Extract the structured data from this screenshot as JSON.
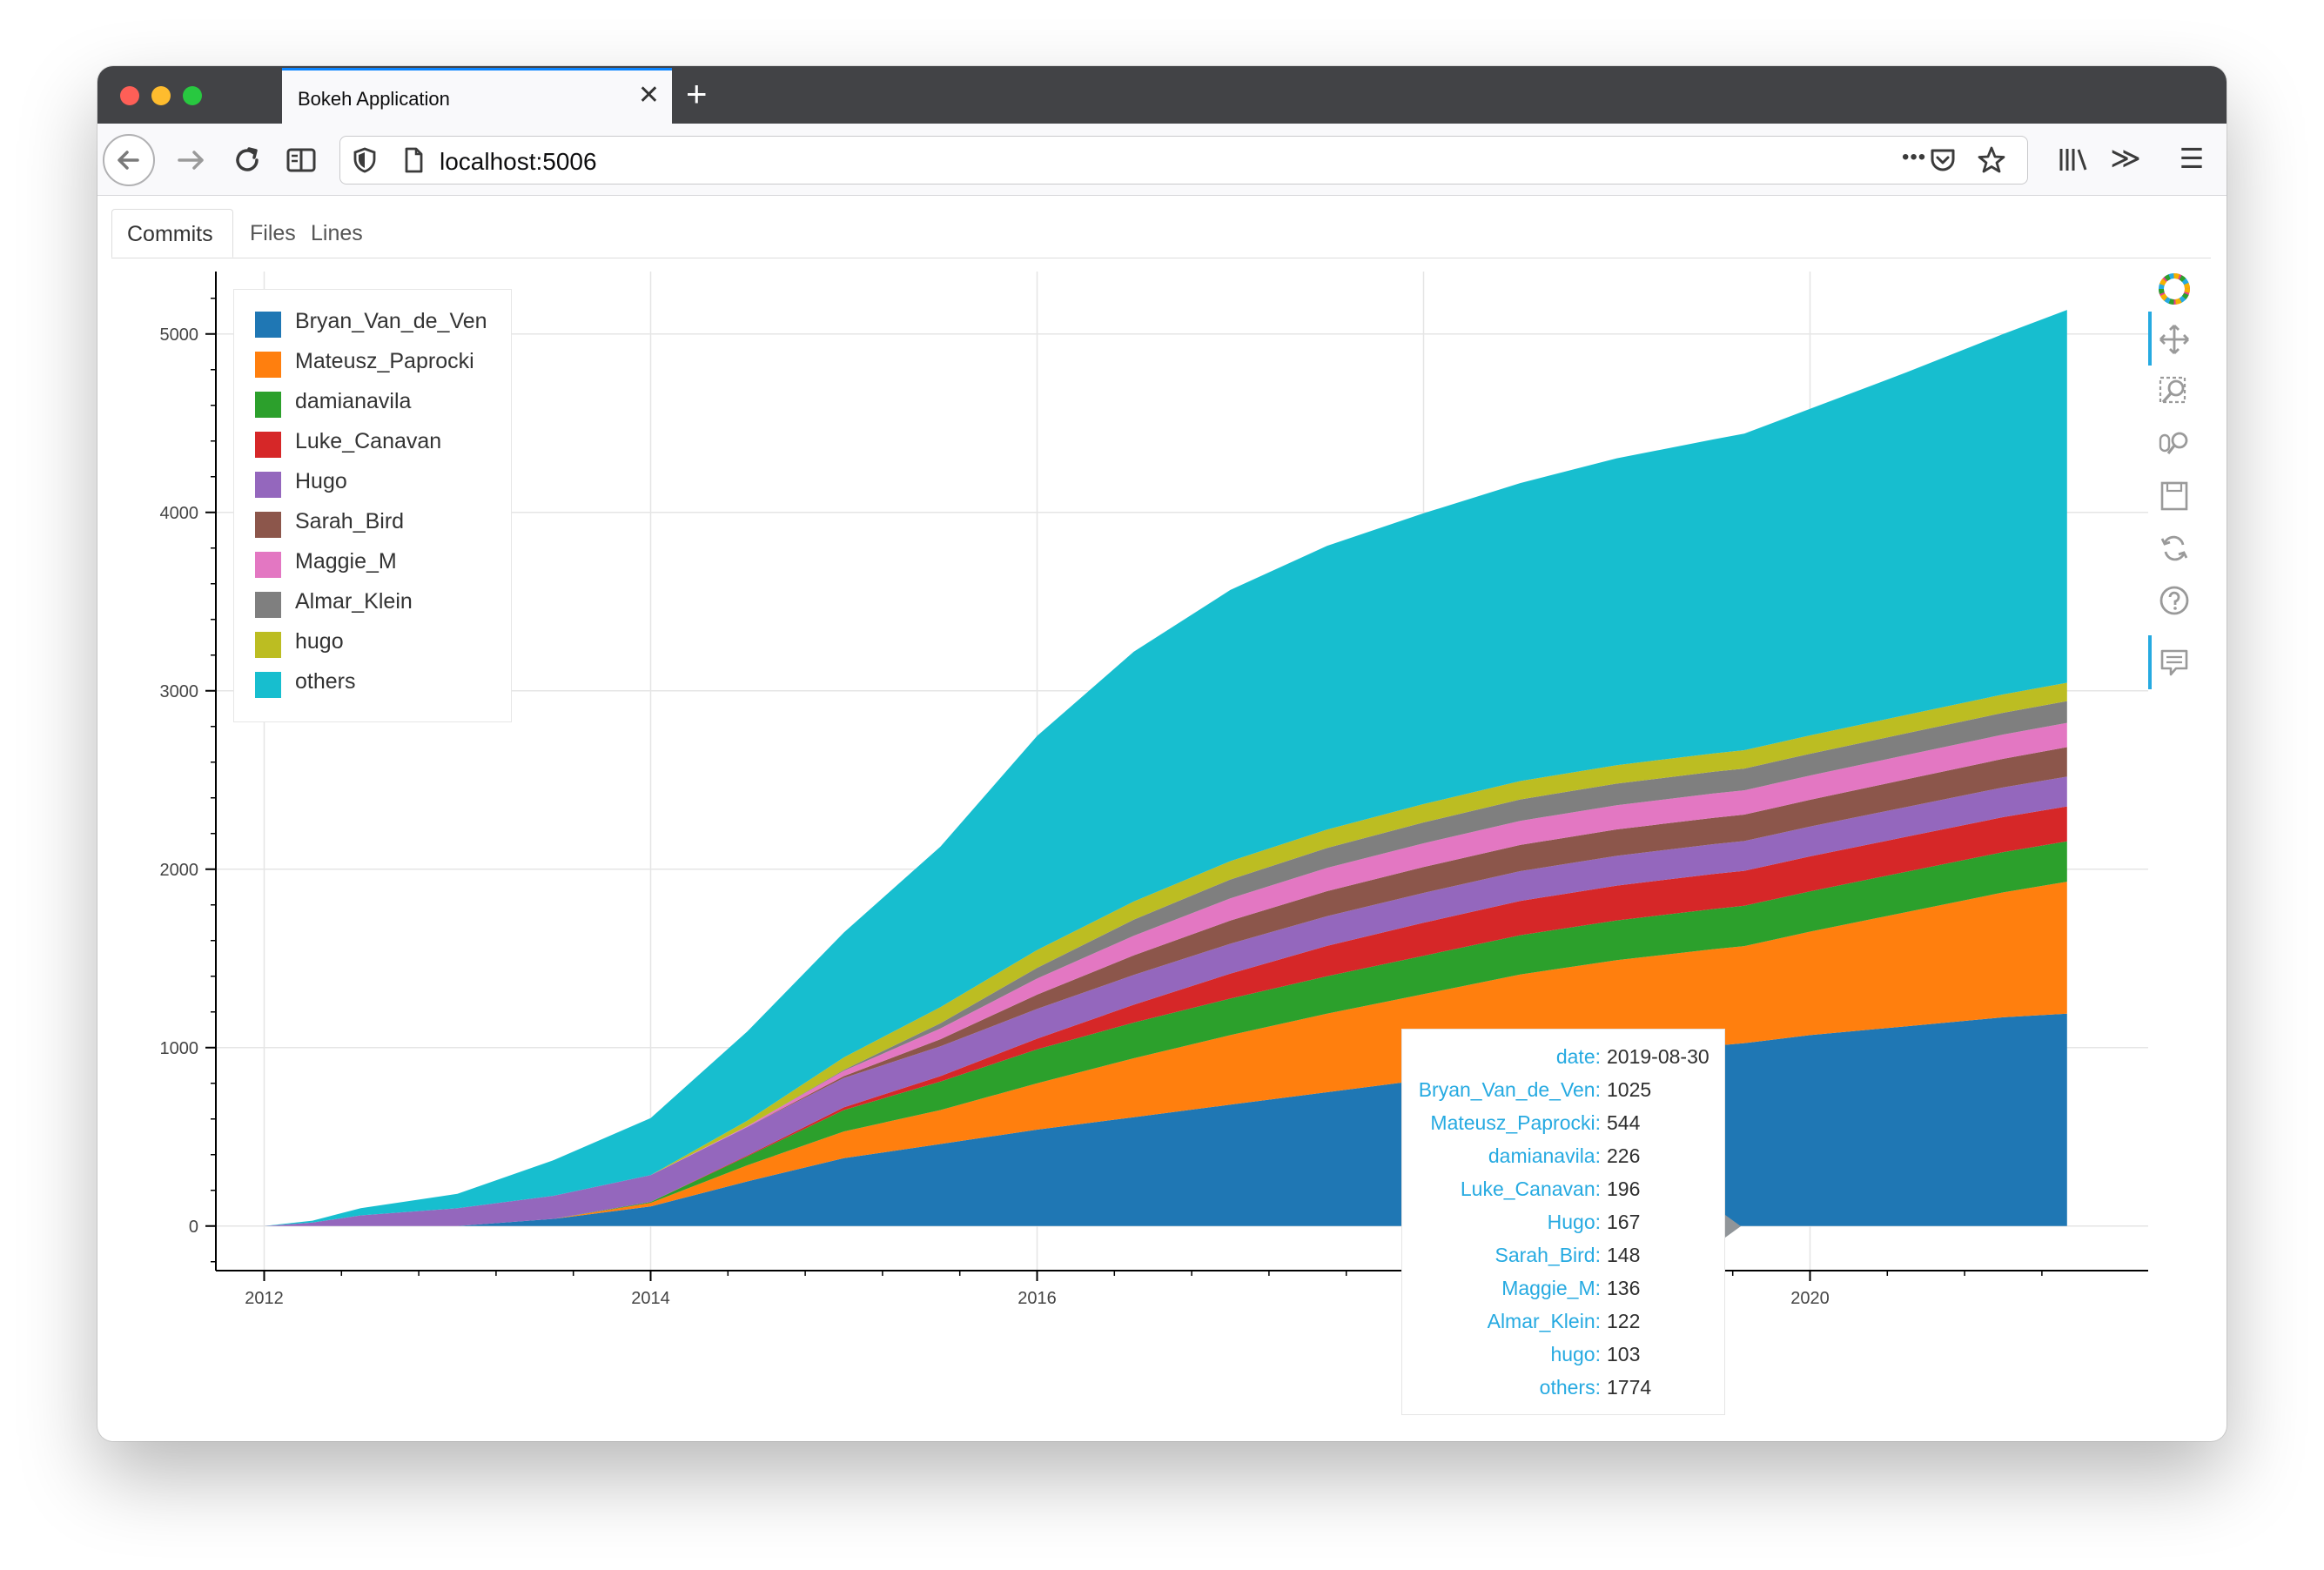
{
  "browser": {
    "tab_title": "Bokeh Application",
    "tab_close": "✕",
    "new_tab": "+",
    "url": "localhost:5006",
    "more_icon": "•••",
    "sidebar_icon": "≫",
    "menu_icon": "☰"
  },
  "page_tabs": [
    {
      "label": "Commits",
      "active": true
    },
    {
      "label": "Files",
      "active": false
    },
    {
      "label": "Lines",
      "active": false
    }
  ],
  "legend": [
    {
      "label": "Bryan_Van_de_Ven",
      "color": "#1f77b4"
    },
    {
      "label": "Mateusz_Paprocki",
      "color": "#ff7f0e"
    },
    {
      "label": "damianavila",
      "color": "#2ca02c"
    },
    {
      "label": "Luke_Canavan",
      "color": "#d62728"
    },
    {
      "label": "Hugo",
      "color": "#9467bd"
    },
    {
      "label": "Sarah_Bird",
      "color": "#8c564b"
    },
    {
      "label": "Maggie_M",
      "color": "#e377c2"
    },
    {
      "label": "Almar_Klein",
      "color": "#7f7f7f"
    },
    {
      "label": "hugo",
      "color": "#bcbd22"
    },
    {
      "label": "others",
      "color": "#17becf"
    }
  ],
  "tooltip": {
    "rows": [
      {
        "key": "date:",
        "value": "2019-08-30"
      },
      {
        "key": "Bryan_Van_de_Ven:",
        "value": "1025"
      },
      {
        "key": "Mateusz_Paprocki:",
        "value": "544"
      },
      {
        "key": "damianavila:",
        "value": "226"
      },
      {
        "key": "Luke_Canavan:",
        "value": "196"
      },
      {
        "key": "Hugo:",
        "value": "167"
      },
      {
        "key": "Sarah_Bird:",
        "value": "148"
      },
      {
        "key": "Maggie_M:",
        "value": "136"
      },
      {
        "key": "Almar_Klein:",
        "value": "122"
      },
      {
        "key": "hugo:",
        "value": "103"
      },
      {
        "key": "others:",
        "value": "1774"
      }
    ]
  },
  "chart_data": {
    "type": "area",
    "stacked": true,
    "title": "",
    "xlabel": "",
    "ylabel": "",
    "x_ticks": [
      "2012",
      "2014",
      "2016",
      "2018",
      "2020"
    ],
    "y_ticks": [
      "0",
      "1000",
      "2000",
      "3000",
      "4000",
      "5000"
    ],
    "xlim": [
      2011.75,
      2021.75
    ],
    "ylim": [
      -250,
      5350
    ],
    "grid": true,
    "legend_position": "top-left",
    "x": [
      2012.0,
      2012.25,
      2012.5,
      2013.0,
      2013.5,
      2014.0,
      2014.5,
      2015.0,
      2015.5,
      2016.0,
      2016.5,
      2017.0,
      2017.5,
      2018.0,
      2018.5,
      2019.0,
      2019.5,
      2019.66,
      2020.0,
      2020.5,
      2021.0,
      2021.33
    ],
    "series": [
      {
        "name": "Bryan_Van_de_Ven",
        "color": "#1f77b4",
        "values": [
          0,
          0,
          0,
          0,
          40,
          110,
          250,
          380,
          460,
          540,
          610,
          680,
          750,
          820,
          900,
          960,
          1010,
          1025,
          1070,
          1120,
          1170,
          1190
        ]
      },
      {
        "name": "Mateusz_Paprocki",
        "color": "#ff7f0e",
        "values": [
          0,
          0,
          0,
          0,
          0,
          20,
          90,
          150,
          190,
          260,
          330,
          390,
          440,
          480,
          510,
          530,
          542,
          544,
          580,
          640,
          700,
          740
        ]
      },
      {
        "name": "damianavila",
        "color": "#2ca02c",
        "values": [
          0,
          0,
          0,
          0,
          0,
          5,
          50,
          120,
          160,
          190,
          200,
          205,
          210,
          215,
          220,
          223,
          225,
          226,
          226,
          226,
          226,
          226
        ]
      },
      {
        "name": "Luke_Canavan",
        "color": "#d62728",
        "values": [
          0,
          0,
          0,
          0,
          0,
          0,
          5,
          15,
          30,
          60,
          100,
          140,
          170,
          185,
          192,
          195,
          196,
          196,
          196,
          196,
          196,
          196
        ]
      },
      {
        "name": "Hugo",
        "color": "#9467bd",
        "values": [
          0,
          20,
          60,
          100,
          130,
          150,
          160,
          165,
          167,
          167,
          167,
          167,
          167,
          167,
          167,
          167,
          167,
          167,
          167,
          167,
          167,
          167
        ]
      },
      {
        "name": "Sarah_Bird",
        "color": "#8c564b",
        "values": [
          0,
          0,
          0,
          0,
          0,
          0,
          0,
          10,
          40,
          80,
          110,
          130,
          140,
          145,
          147,
          148,
          148,
          148,
          150,
          155,
          160,
          165
        ]
      },
      {
        "name": "Maggie_M",
        "color": "#e377c2",
        "values": [
          0,
          0,
          0,
          0,
          0,
          0,
          5,
          30,
          60,
          90,
          110,
          125,
          130,
          133,
          135,
          136,
          136,
          136,
          136,
          136,
          136,
          136
        ]
      },
      {
        "name": "Almar_Klein",
        "color": "#7f7f7f",
        "values": [
          0,
          0,
          0,
          0,
          0,
          0,
          0,
          5,
          30,
          60,
          90,
          105,
          112,
          117,
          120,
          121,
          122,
          122,
          122,
          122,
          122,
          122
        ]
      },
      {
        "name": "hugo",
        "color": "#bcbd22",
        "values": [
          0,
          0,
          0,
          0,
          0,
          0,
          30,
          70,
          90,
          100,
          102,
          103,
          103,
          103,
          103,
          103,
          103,
          103,
          103,
          103,
          103,
          103
        ]
      },
      {
        "name": "others",
        "color": "#17becf",
        "values": [
          0,
          10,
          40,
          80,
          200,
          320,
          500,
          700,
          900,
          1200,
          1400,
          1520,
          1590,
          1630,
          1670,
          1720,
          1760,
          1774,
          1830,
          1920,
          2020,
          2090
        ]
      }
    ],
    "tooltip_marker_x": 2019.66
  },
  "colors": {
    "tooltip_key": "#26aae1",
    "toolbar_active": "#26aae1"
  }
}
